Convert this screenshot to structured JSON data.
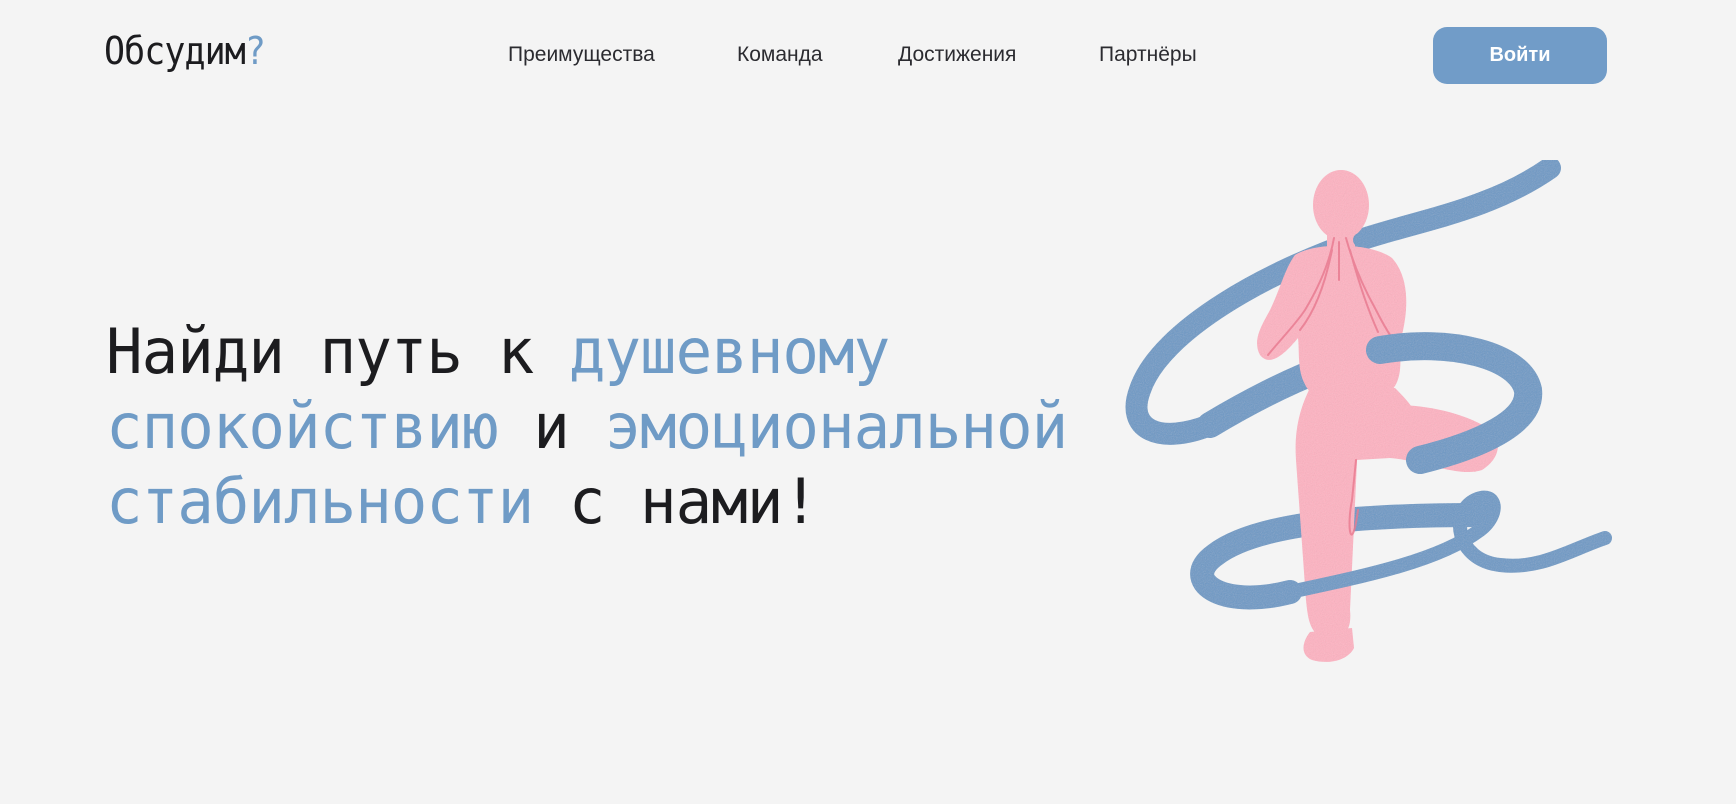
{
  "header": {
    "logo_text": "Обсудим",
    "logo_mark": "?",
    "nav": [
      {
        "label": "Преимущества"
      },
      {
        "label": "Команда"
      },
      {
        "label": "Достижения"
      },
      {
        "label": "Партнёры"
      }
    ],
    "login_label": "Войти"
  },
  "hero": {
    "segments": [
      {
        "text": "Найди путь к ",
        "accent": false
      },
      {
        "text": "душевному",
        "accent": true
      },
      {
        "text": "спокойствию",
        "accent": true
      },
      {
        "text": " и ",
        "accent": false
      },
      {
        "text": "эмоциональной",
        "accent": true
      },
      {
        "text": "стабильности",
        "accent": true
      },
      {
        "text": " с нами!",
        "accent": false
      }
    ]
  },
  "illustration": {
    "icon": "meditating-person-with-ribbon",
    "colors": {
      "figure": "#ffb3c2",
      "ribbon": "#6c99c6",
      "figure_lines": "#e8798f"
    }
  },
  "colors": {
    "accent": "#6f9bc6",
    "text": "#1c1c1f",
    "background": "#f4f4f4",
    "button": "#719cc8"
  }
}
